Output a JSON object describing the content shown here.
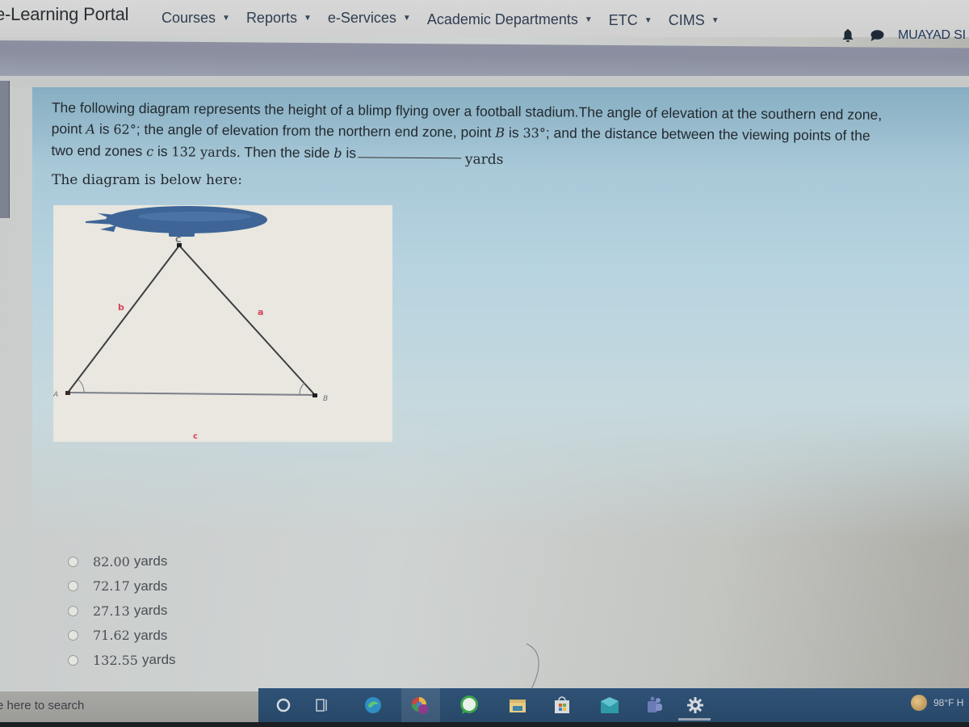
{
  "navbar": {
    "brand": "e-Learning Portal",
    "menu": [
      {
        "label": "Courses",
        "icon": "caret-down"
      },
      {
        "label": "Reports",
        "icon": "caret-down"
      },
      {
        "label": "e-Services",
        "icon": "caret-down"
      },
      {
        "label": "Academic Departments",
        "icon": "caret-down"
      },
      {
        "label": "ETC",
        "icon": "caret-down"
      },
      {
        "label": "CIMS",
        "icon": "caret-down"
      }
    ],
    "notifications_icon": "bell-icon",
    "messages_icon": "chat-bubble-icon",
    "user_name": "MUAYAD SI",
    "caret": "▼"
  },
  "question": {
    "line1": "The following diagram represents the height of a blimp flying over a football stadium.The angle of elevation at the southern end zone,",
    "line2_pre": "point ",
    "point_a": "A",
    "line2_is": " is ",
    "angle_a": "62°",
    "line2_mid": "; the angle of elevation from the northern end zone, point ",
    "point_b": "B",
    "line2_is2": " is ",
    "angle_b": "33°",
    "line2_post": "; and the distance between the viewing points of the",
    "line3_pre": "two end zones ",
    "side_c": "c",
    "line3_is": " is ",
    "distance": "132",
    "line3_units": " yards.",
    "line3_post": " Then the side ",
    "side_b": "b",
    "line3_is2": " is",
    "answer_suffix": "yards",
    "diagram_caption": "The diagram is below here:"
  },
  "diagram": {
    "vertices": {
      "A": "A",
      "B": "B",
      "C": "C"
    },
    "sides": {
      "a": "a",
      "b": "b",
      "c": "c"
    },
    "blimp_color": "#3f6597",
    "side_label_color": "#d9435b"
  },
  "options": [
    {
      "value": "82.00",
      "unit": "yards",
      "selected": false
    },
    {
      "value": "72.17",
      "unit": "yards",
      "selected": false
    },
    {
      "value": "27.13",
      "unit": "yards",
      "selected": false
    },
    {
      "value": "71.62",
      "unit": "yards",
      "selected": false
    },
    {
      "value": "132.55",
      "unit": "yards",
      "selected": false
    }
  ],
  "taskbar": {
    "search_placeholder": "e here to search",
    "apps": [
      "cortana",
      "task-view",
      "edge",
      "chrome",
      "whatsapp",
      "file-explorer",
      "store",
      "mail",
      "teams",
      "settings"
    ],
    "weather": "98°F H"
  }
}
